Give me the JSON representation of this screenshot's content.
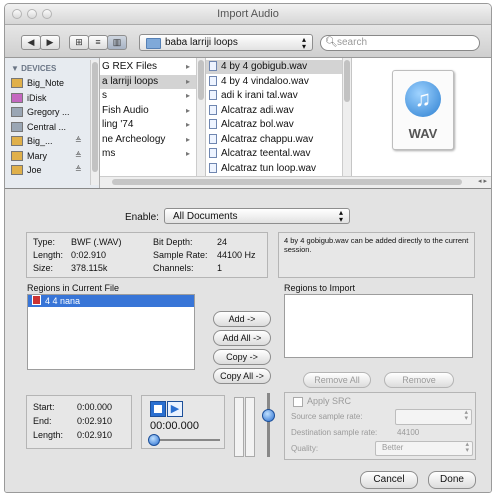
{
  "window": {
    "title": "Import Audio"
  },
  "toolbar": {
    "back_icon": "back-arrow-icon",
    "forward_icon": "forward-arrow-icon",
    "location": "baba larriji loops",
    "search_placeholder": "search"
  },
  "sidebar": {
    "header": "DEVICES",
    "items": [
      {
        "label": "Big_Note",
        "icon": "disk-icon",
        "eject": ""
      },
      {
        "label": "iDisk",
        "icon": "idisk-icon",
        "eject": ""
      },
      {
        "label": "Gregory ...",
        "icon": "computer-icon",
        "eject": ""
      },
      {
        "label": "Central ...",
        "icon": "computer-icon",
        "eject": ""
      },
      {
        "label": "Big_...",
        "icon": "disk-icon",
        "eject": "≜"
      },
      {
        "label": "Mary",
        "icon": "disk-icon",
        "eject": "≜"
      },
      {
        "label": "Joe",
        "icon": "disk-icon",
        "eject": "≜"
      }
    ]
  },
  "column1": {
    "items": [
      {
        "label": "G REX Files",
        "arrow": "▸"
      },
      {
        "label": "a larriji loops",
        "arrow": "▸"
      },
      {
        "label": "s",
        "arrow": "▸"
      },
      {
        "label": "Fish Audio",
        "arrow": "▸"
      },
      {
        "label": "ling '74",
        "arrow": "▸"
      },
      {
        "label": "ne Archeology",
        "arrow": "▸"
      },
      {
        "label": "ms",
        "arrow": "▸"
      }
    ]
  },
  "column2": {
    "items": [
      {
        "label": "4 by 4 gobigub.wav"
      },
      {
        "label": "4 by 4 vindaloo.wav"
      },
      {
        "label": "adi k irani tal.wav"
      },
      {
        "label": "Alcatraz adi.wav"
      },
      {
        "label": "Alcatraz bol.wav"
      },
      {
        "label": "Alcatraz chappu.wav"
      },
      {
        "label": "Alcatraz teental.wav"
      },
      {
        "label": "Alcatraz tun loop.wav"
      }
    ]
  },
  "preview": {
    "badge": "WAV"
  },
  "enable": {
    "label": "Enable:",
    "value": "All Documents"
  },
  "info": {
    "type_label": "Type:",
    "type_value": "BWF (.WAV)",
    "length_label": "Length:",
    "length_value": "0:02.910",
    "size_label": "Size:",
    "size_value": "378.115k",
    "bitdepth_label": "Bit Depth:",
    "bitdepth_value": "24",
    "samplerate_label": "Sample Rate:",
    "samplerate_value": "44100 Hz",
    "channels_label": "Channels:",
    "channels_value": "1",
    "message": "4 by 4 gobigub.wav can be added directly to the current session."
  },
  "regions_current": {
    "label": "Regions in Current File",
    "items": [
      "4 4 nana"
    ]
  },
  "regions_import": {
    "label": "Regions to Import"
  },
  "buttons": {
    "add": "Add ->",
    "add_all": "Add All ->",
    "copy": "Copy ->",
    "copy_all": "Copy All ->",
    "remove_all": "Remove All",
    "remove": "Remove",
    "cancel": "Cancel",
    "done": "Done"
  },
  "region_info": {
    "start_label": "Start:",
    "start_value": "0:00.000",
    "end_label": "End:",
    "end_value": "0:02.910",
    "length_label": "Length:",
    "length_value": "0:02.910"
  },
  "transport": {
    "time": "00:00.000"
  },
  "src": {
    "apply_label": "Apply SRC",
    "source_rate_label": "Source sample rate:",
    "dest_rate_label": "Destination sample rate:",
    "dest_rate_value": "44100",
    "quality_label": "Quality:",
    "quality_value": "Better"
  }
}
